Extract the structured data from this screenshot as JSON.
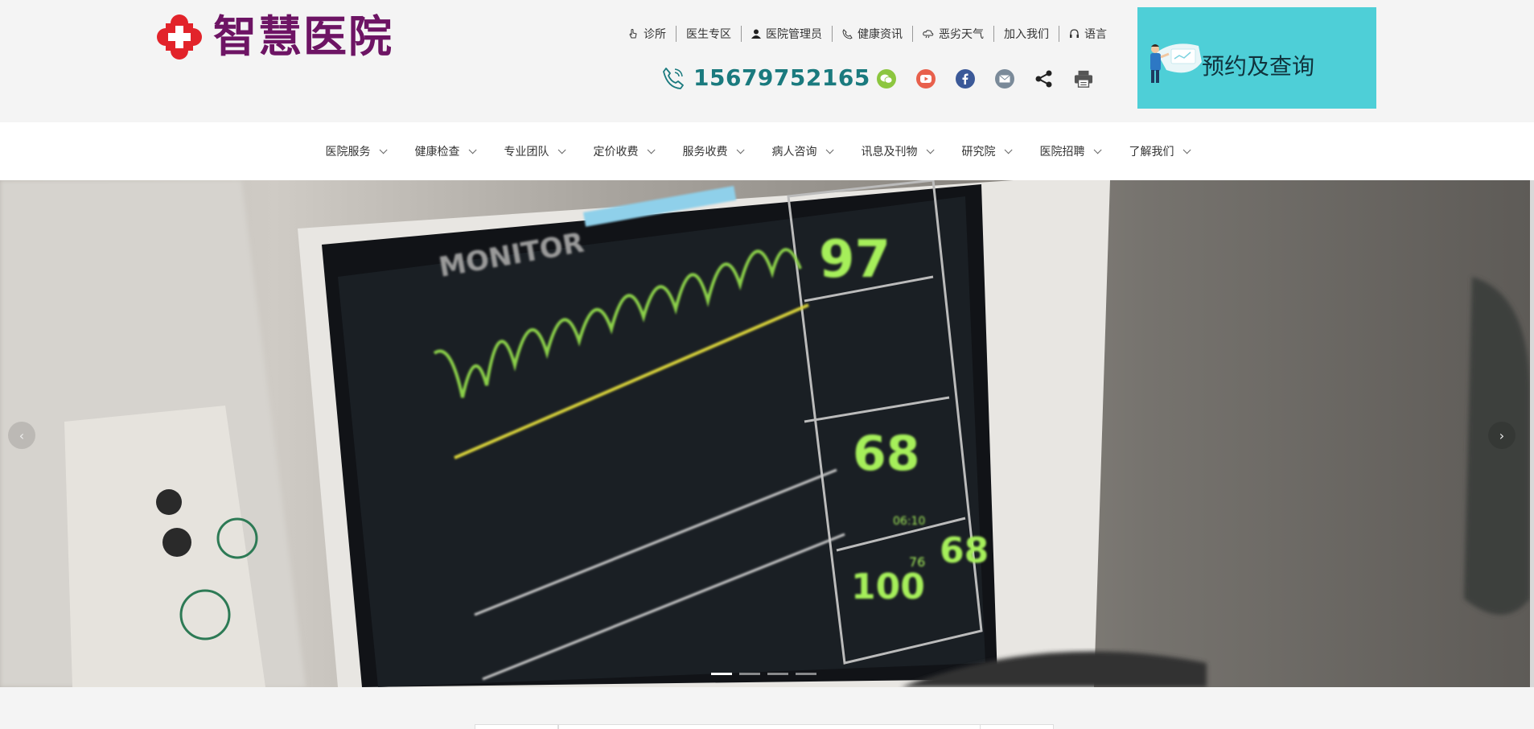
{
  "brand": {
    "name": "智慧医院",
    "accent": "#6d1464",
    "cross_color": "#e2232a"
  },
  "toplinks": [
    {
      "label": "诊所",
      "icon": "hand-pointer-icon"
    },
    {
      "label": "医生专区",
      "icon": ""
    },
    {
      "label": "医院管理员",
      "icon": "user-icon"
    },
    {
      "label": "健康资讯",
      "icon": "phone-small-icon"
    },
    {
      "label": "恶劣天气",
      "icon": "cloud-icon"
    },
    {
      "label": "加入我们",
      "icon": ""
    },
    {
      "label": "语言",
      "icon": "headset-icon"
    }
  ],
  "phone": {
    "number": "15679752165",
    "color": "#1a7a7e"
  },
  "socials": [
    {
      "name": "wechat-icon",
      "color": "#8cc63f"
    },
    {
      "name": "youtube-icon",
      "color": "#e8604c"
    },
    {
      "name": "facebook-icon",
      "color": "#3b5998"
    },
    {
      "name": "mail-icon",
      "color": "#7a8a99"
    },
    {
      "name": "share-icon",
      "color": "#222222"
    },
    {
      "name": "print-icon",
      "color": "#555555"
    }
  ],
  "appointment": {
    "label": "预约及查询",
    "bg": "#4ecfd7"
  },
  "nav": [
    {
      "label": "医院服务"
    },
    {
      "label": "健康检查"
    },
    {
      "label": "专业团队"
    },
    {
      "label": "定价收费"
    },
    {
      "label": "服务收费"
    },
    {
      "label": "病人咨询"
    },
    {
      "label": "讯息及刊物"
    },
    {
      "label": "研究院"
    },
    {
      "label": "医院招聘"
    },
    {
      "label": "了解我们"
    }
  ],
  "hero": {
    "monitor_brand": "MONITOR",
    "readouts": {
      "spo2": "97",
      "ecg": "68",
      "nibp": "100",
      "nibp_low": "76",
      "pr": "68",
      "time": "06:10"
    },
    "slides": 4,
    "active_slide": 1,
    "prev_glyph": "‹",
    "next_glyph": "›"
  }
}
